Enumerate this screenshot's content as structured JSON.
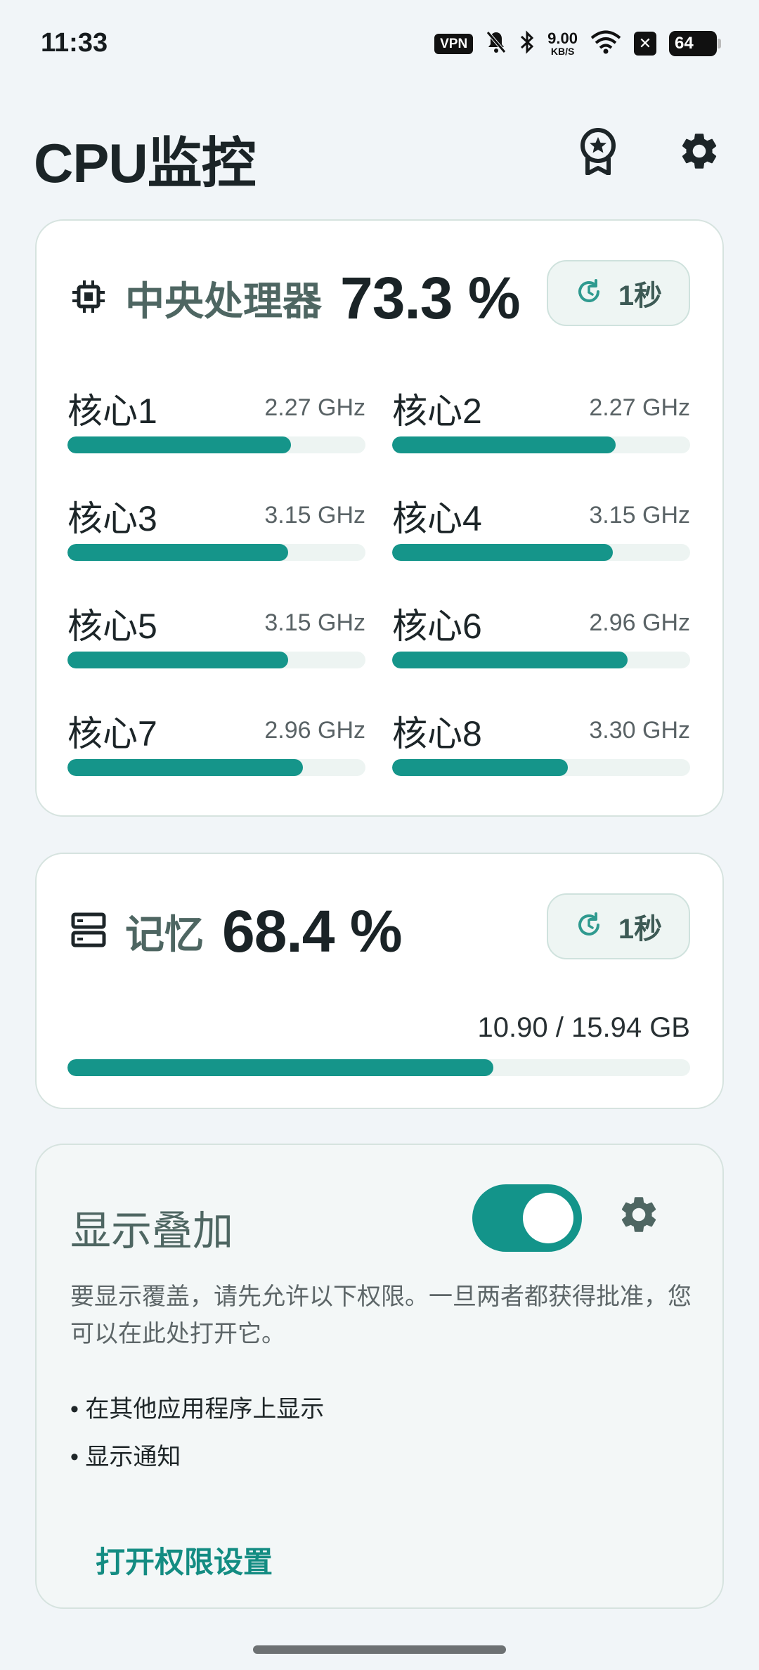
{
  "status_bar": {
    "time": "11:33",
    "vpn_label": "VPN",
    "net_speed_value": "9.00",
    "net_speed_unit": "KB/S",
    "battery": "64"
  },
  "header": {
    "title": "CPU监控"
  },
  "cpu_card": {
    "label": "中央处理器",
    "usage": "73.3 %",
    "interval": "1秒",
    "cores": [
      {
        "name": "核心1",
        "freq": "2.27 GHz",
        "load": 0.75
      },
      {
        "name": "核心2",
        "freq": "2.27 GHz",
        "load": 0.75
      },
      {
        "name": "核心3",
        "freq": "3.15 GHz",
        "load": 0.74
      },
      {
        "name": "核心4",
        "freq": "3.15 GHz",
        "load": 0.74
      },
      {
        "name": "核心5",
        "freq": "3.15 GHz",
        "load": 0.74
      },
      {
        "name": "核心6",
        "freq": "2.96 GHz",
        "load": 0.79
      },
      {
        "name": "核心7",
        "freq": "2.96 GHz",
        "load": 0.79
      },
      {
        "name": "核心8",
        "freq": "3.30 GHz",
        "load": 0.59
      }
    ]
  },
  "memory_card": {
    "label": "记忆",
    "usage": "68.4 %",
    "interval": "1秒",
    "usage_detail": "10.90 / 15.94 GB",
    "fraction": 0.684
  },
  "overlay_card": {
    "title": "显示叠加",
    "toggle_on": true,
    "description": "要显示覆盖，请先允许以下权限。一旦两者都获得批准，您可以在此处打开它。",
    "permissions": [
      "• 在其他应用程序上显示",
      "• 显示通知"
    ],
    "open_settings_label": "打开权限设置"
  },
  "colors": {
    "accent": "#15958a",
    "background": "#f1f5f8",
    "label_gray_green": "#4e6662"
  }
}
